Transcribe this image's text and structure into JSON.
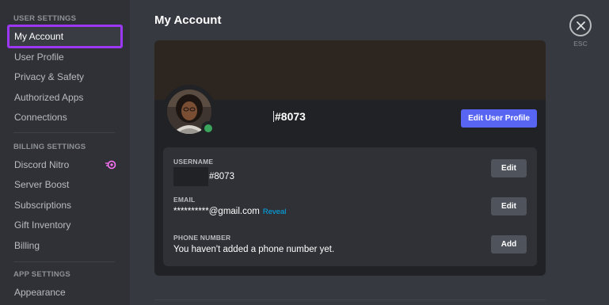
{
  "sidebar": {
    "sections": [
      {
        "header": "User Settings",
        "items": [
          {
            "label": "My Account",
            "selected": true
          },
          {
            "label": "User Profile"
          },
          {
            "label": "Privacy & Safety"
          },
          {
            "label": "Authorized Apps"
          },
          {
            "label": "Connections"
          }
        ]
      },
      {
        "header": "Billing Settings",
        "items": [
          {
            "label": "Discord Nitro",
            "icon": "nitro-icon"
          },
          {
            "label": "Server Boost"
          },
          {
            "label": "Subscriptions"
          },
          {
            "label": "Gift Inventory"
          },
          {
            "label": "Billing"
          }
        ]
      },
      {
        "header": "App Settings",
        "items": [
          {
            "label": "Appearance"
          }
        ]
      }
    ]
  },
  "page": {
    "title": "My Account"
  },
  "close": {
    "label": "ESC",
    "icon": "close-icon"
  },
  "profile": {
    "tag": "#8073",
    "edit_button": "Edit User Profile",
    "status": "online",
    "status_color": "#3ba55d"
  },
  "fields": [
    {
      "label": "Username",
      "value": "#8073",
      "action": "Edit"
    },
    {
      "label": "Email",
      "value": "**********@gmail.com",
      "link": "Reveal",
      "action": "Edit"
    },
    {
      "label": "Phone Number",
      "value": "You haven't added a phone number yet.",
      "action": "Add"
    }
  ],
  "colors": {
    "accent": "#5865f2",
    "selection_outline": "#9b37f5",
    "link": "#00aff4"
  }
}
